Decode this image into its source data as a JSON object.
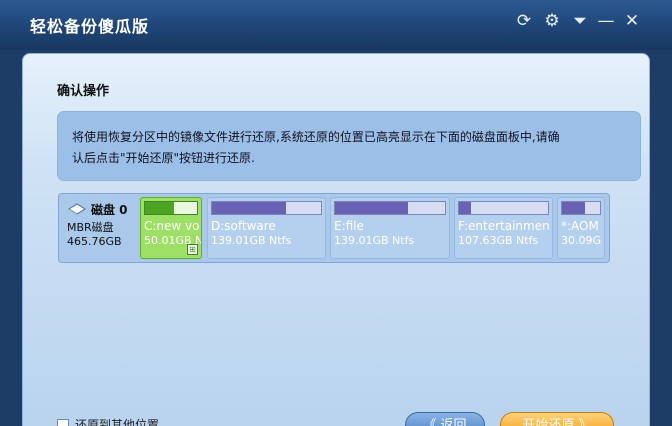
{
  "app": {
    "title": "轻松备份傻瓜版",
    "controls": {
      "refresh": "⟳",
      "settings": "⚙",
      "menu": "⏷",
      "minimize": "—",
      "close": "✕"
    }
  },
  "panel": {
    "section_title": "确认操作",
    "info_line1": "将使用恢复分区中的镜像文件进行还原,系统还原的位置已高亮显示在下面的磁盘面板中,请确",
    "info_line2": "认后点击\"开始还原\"按钮进行还原."
  },
  "disk": {
    "name": "磁盘 0",
    "type": "MBR磁盘",
    "size": "465.76GB",
    "partitions": [
      {
        "label": "C:new vo",
        "size": "50.01GB N",
        "used_fraction": 0.55,
        "selected": true
      },
      {
        "label": "D:software",
        "size": "139.01GB Ntfs",
        "used_fraction": 0.68,
        "selected": false
      },
      {
        "label": "E:file",
        "size": "139.01GB Ntfs",
        "used_fraction": 0.66,
        "selected": false
      },
      {
        "label": "F:entertainmen",
        "size": "107.63GB Ntfs",
        "used_fraction": 0.14,
        "selected": false
      },
      {
        "label": "*:AOM",
        "size": "30.09G",
        "used_fraction": 0.6,
        "selected": false
      }
    ]
  },
  "footer": {
    "checkbox_label": "还原到其他位置",
    "back_label": "《 返回",
    "start_label": "开始还原 》"
  }
}
